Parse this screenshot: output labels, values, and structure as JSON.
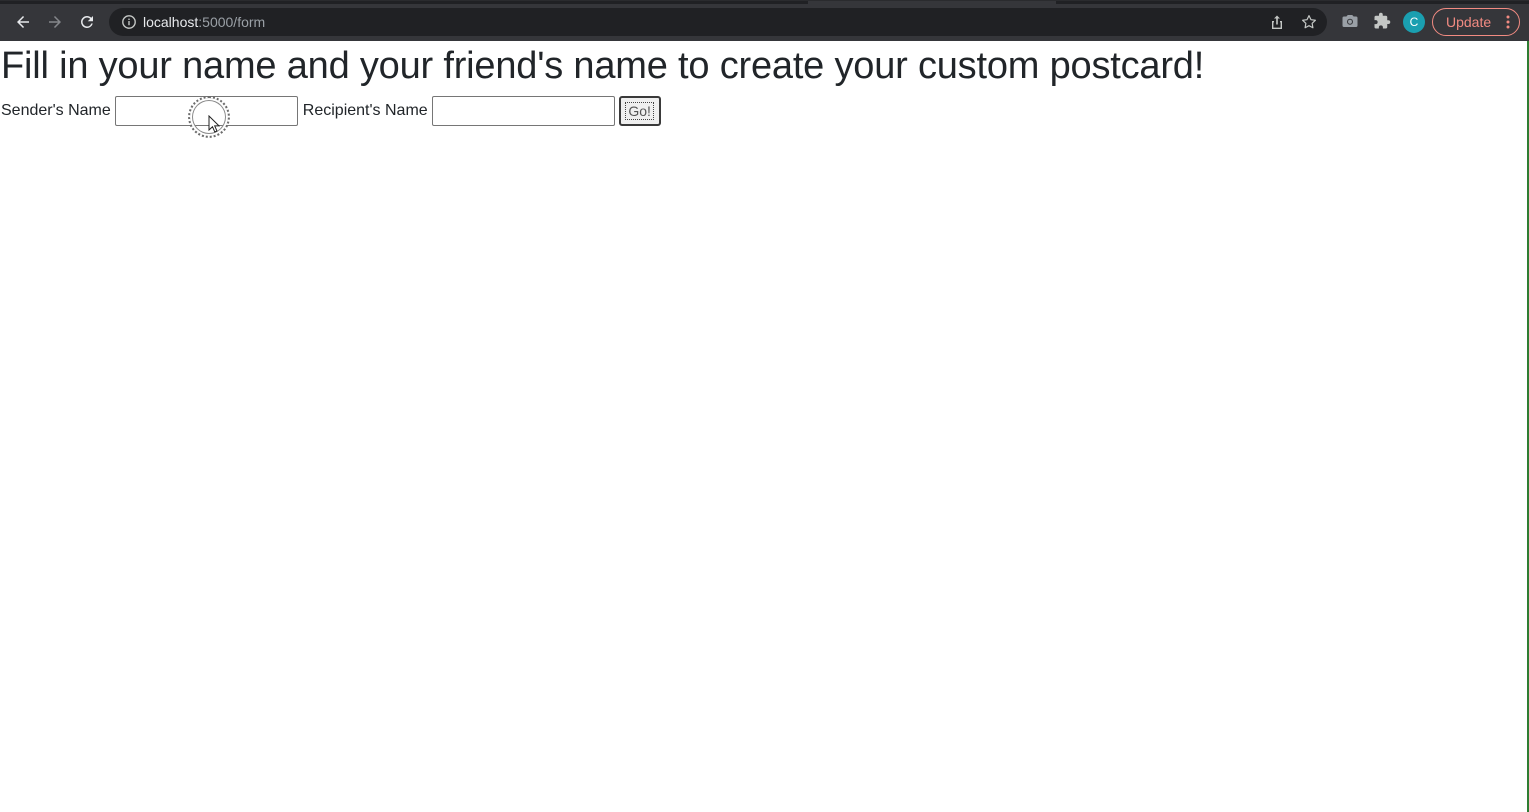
{
  "browser": {
    "url_host": "localhost",
    "url_path": ":5000/form",
    "avatar_letter": "C",
    "update_label": "Update"
  },
  "page": {
    "heading": "Fill in your name and your friend's name to create your custom postcard!",
    "sender_label": "Sender's Name",
    "sender_value": "",
    "recipient_label": "Recipient's Name",
    "recipient_value": "",
    "submit_label": "Go!"
  },
  "colors": {
    "chrome_bg": "#35363a",
    "omnibox_bg": "#202124",
    "update_accent": "#f28b82",
    "avatar_bg": "#1a9fb0",
    "text": "#212529"
  }
}
